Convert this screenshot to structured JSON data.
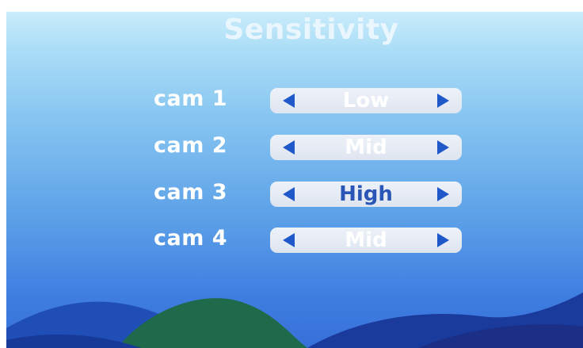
{
  "screen": {
    "title": "Sensitivity"
  },
  "cameras": [
    {
      "label": "cam 1",
      "value": "Low"
    },
    {
      "label": "cam 2",
      "value": "Mid"
    },
    {
      "label": "cam 3",
      "value": "High"
    },
    {
      "label": "cam 4",
      "value": "Mid"
    }
  ],
  "selected_row": "cam 3",
  "icons": {
    "left": "arrow-left-icon",
    "right": "arrow-right-icon"
  },
  "colors": {
    "arrow": "#1f58c8",
    "selected_value_text": "#2a56b8",
    "value_text": "#ffffff"
  }
}
